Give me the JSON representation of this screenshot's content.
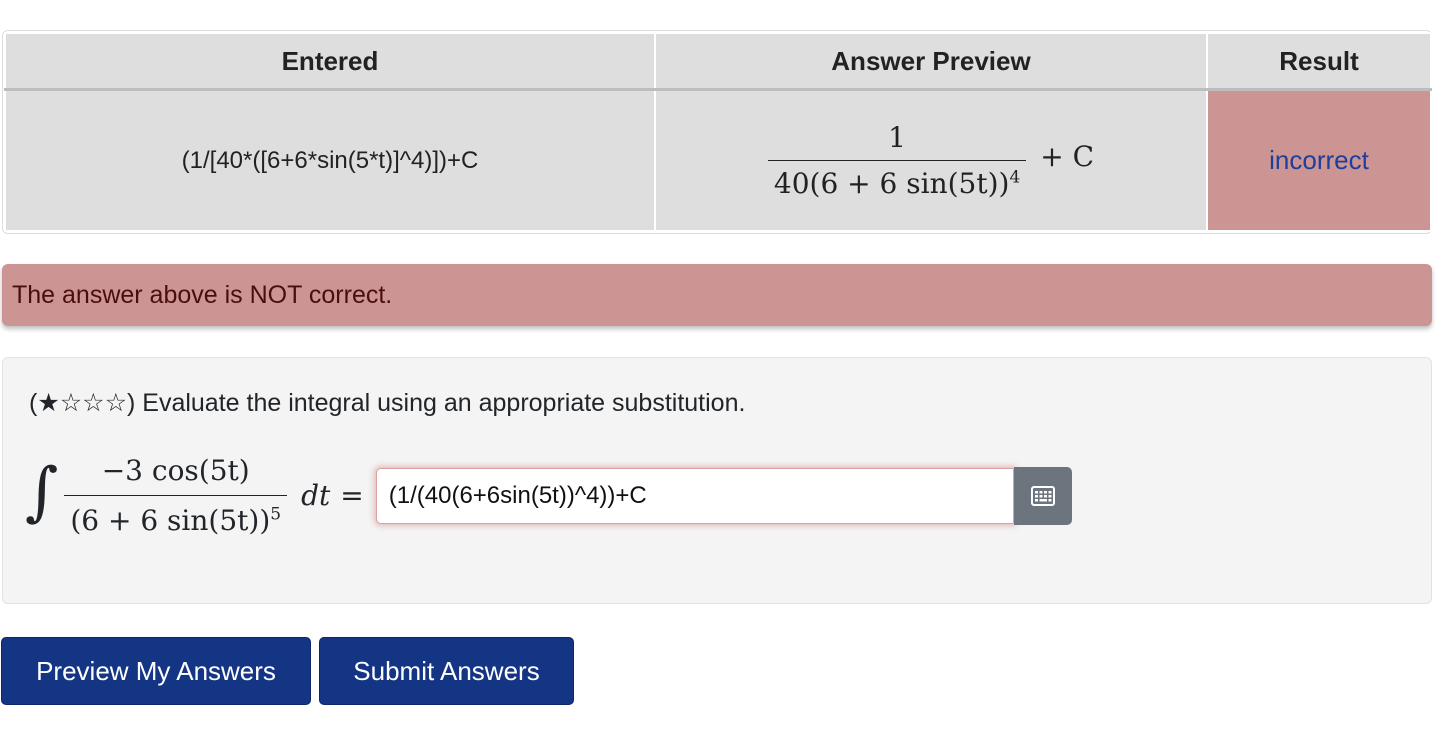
{
  "results_table": {
    "headers": [
      "Entered",
      "Answer Preview",
      "Result"
    ],
    "row": {
      "entered": "(1/[40*([6+6*sin(5*t)]^4)])+C",
      "preview": {
        "numerator": "1",
        "denominator": "40(6 + 6 sin(5t))",
        "exponent": "4",
        "suffix": "+ C"
      },
      "result": "incorrect"
    }
  },
  "alert": {
    "message": "The answer above is NOT correct."
  },
  "problem": {
    "difficulty_stars": "★☆☆☆",
    "prompt_text": "Evaluate the integral using an appropriate substitution.",
    "integral": {
      "numerator": "−3 cos(5t)",
      "denominator": "(6 + 6 sin(5t))",
      "exponent": "5",
      "dt": "dt",
      "equals": "="
    },
    "answer_value": "(1/(40(6+6sin(5t))^4))+C",
    "keypad_icon": "keypad-icon"
  },
  "buttons": {
    "preview_label": "Preview My Answers",
    "submit_label": "Submit Answers"
  },
  "colors": {
    "incorrect_bg": "#cc9493",
    "button_bg": "#143484",
    "link": "#1e3f99"
  }
}
